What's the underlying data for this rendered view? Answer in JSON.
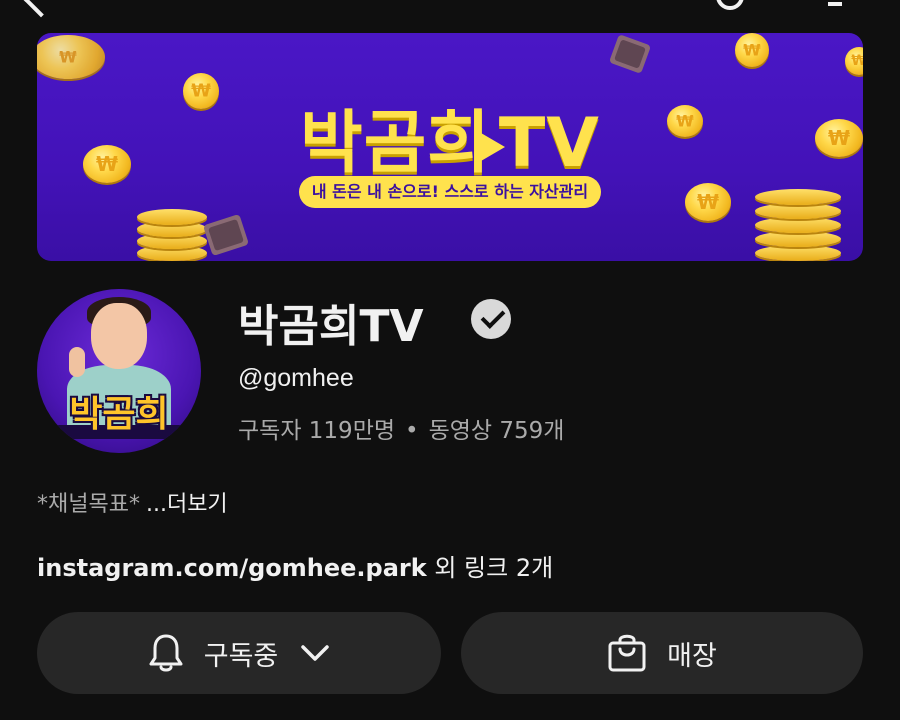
{
  "banner": {
    "title": "박곰희",
    "title_suffix": "TV",
    "tagline": "내 돈은 내 손으로! 스스로 하는 자산관리",
    "accent_color": "#ffe24d",
    "bg_color": "#4312b8"
  },
  "avatar": {
    "label": "박곰희"
  },
  "channel": {
    "name": "박곰희TV",
    "verified_icon": "check-circle-icon",
    "handle": "@gomhee",
    "subscribers": "구독자 119만명",
    "separator": "•",
    "videos": "동영상 759개"
  },
  "description": {
    "text": "*채널목표*",
    "more": "...더보기"
  },
  "links": {
    "url": "instagram.com/gomhee.park",
    "extra": " 외 링크 2개"
  },
  "buttons": {
    "subscribe": {
      "icon": "bell-icon",
      "label": "구독중",
      "chevron": "chevron-down-icon"
    },
    "store": {
      "icon": "shopping-bag-icon",
      "label": "매장"
    }
  }
}
